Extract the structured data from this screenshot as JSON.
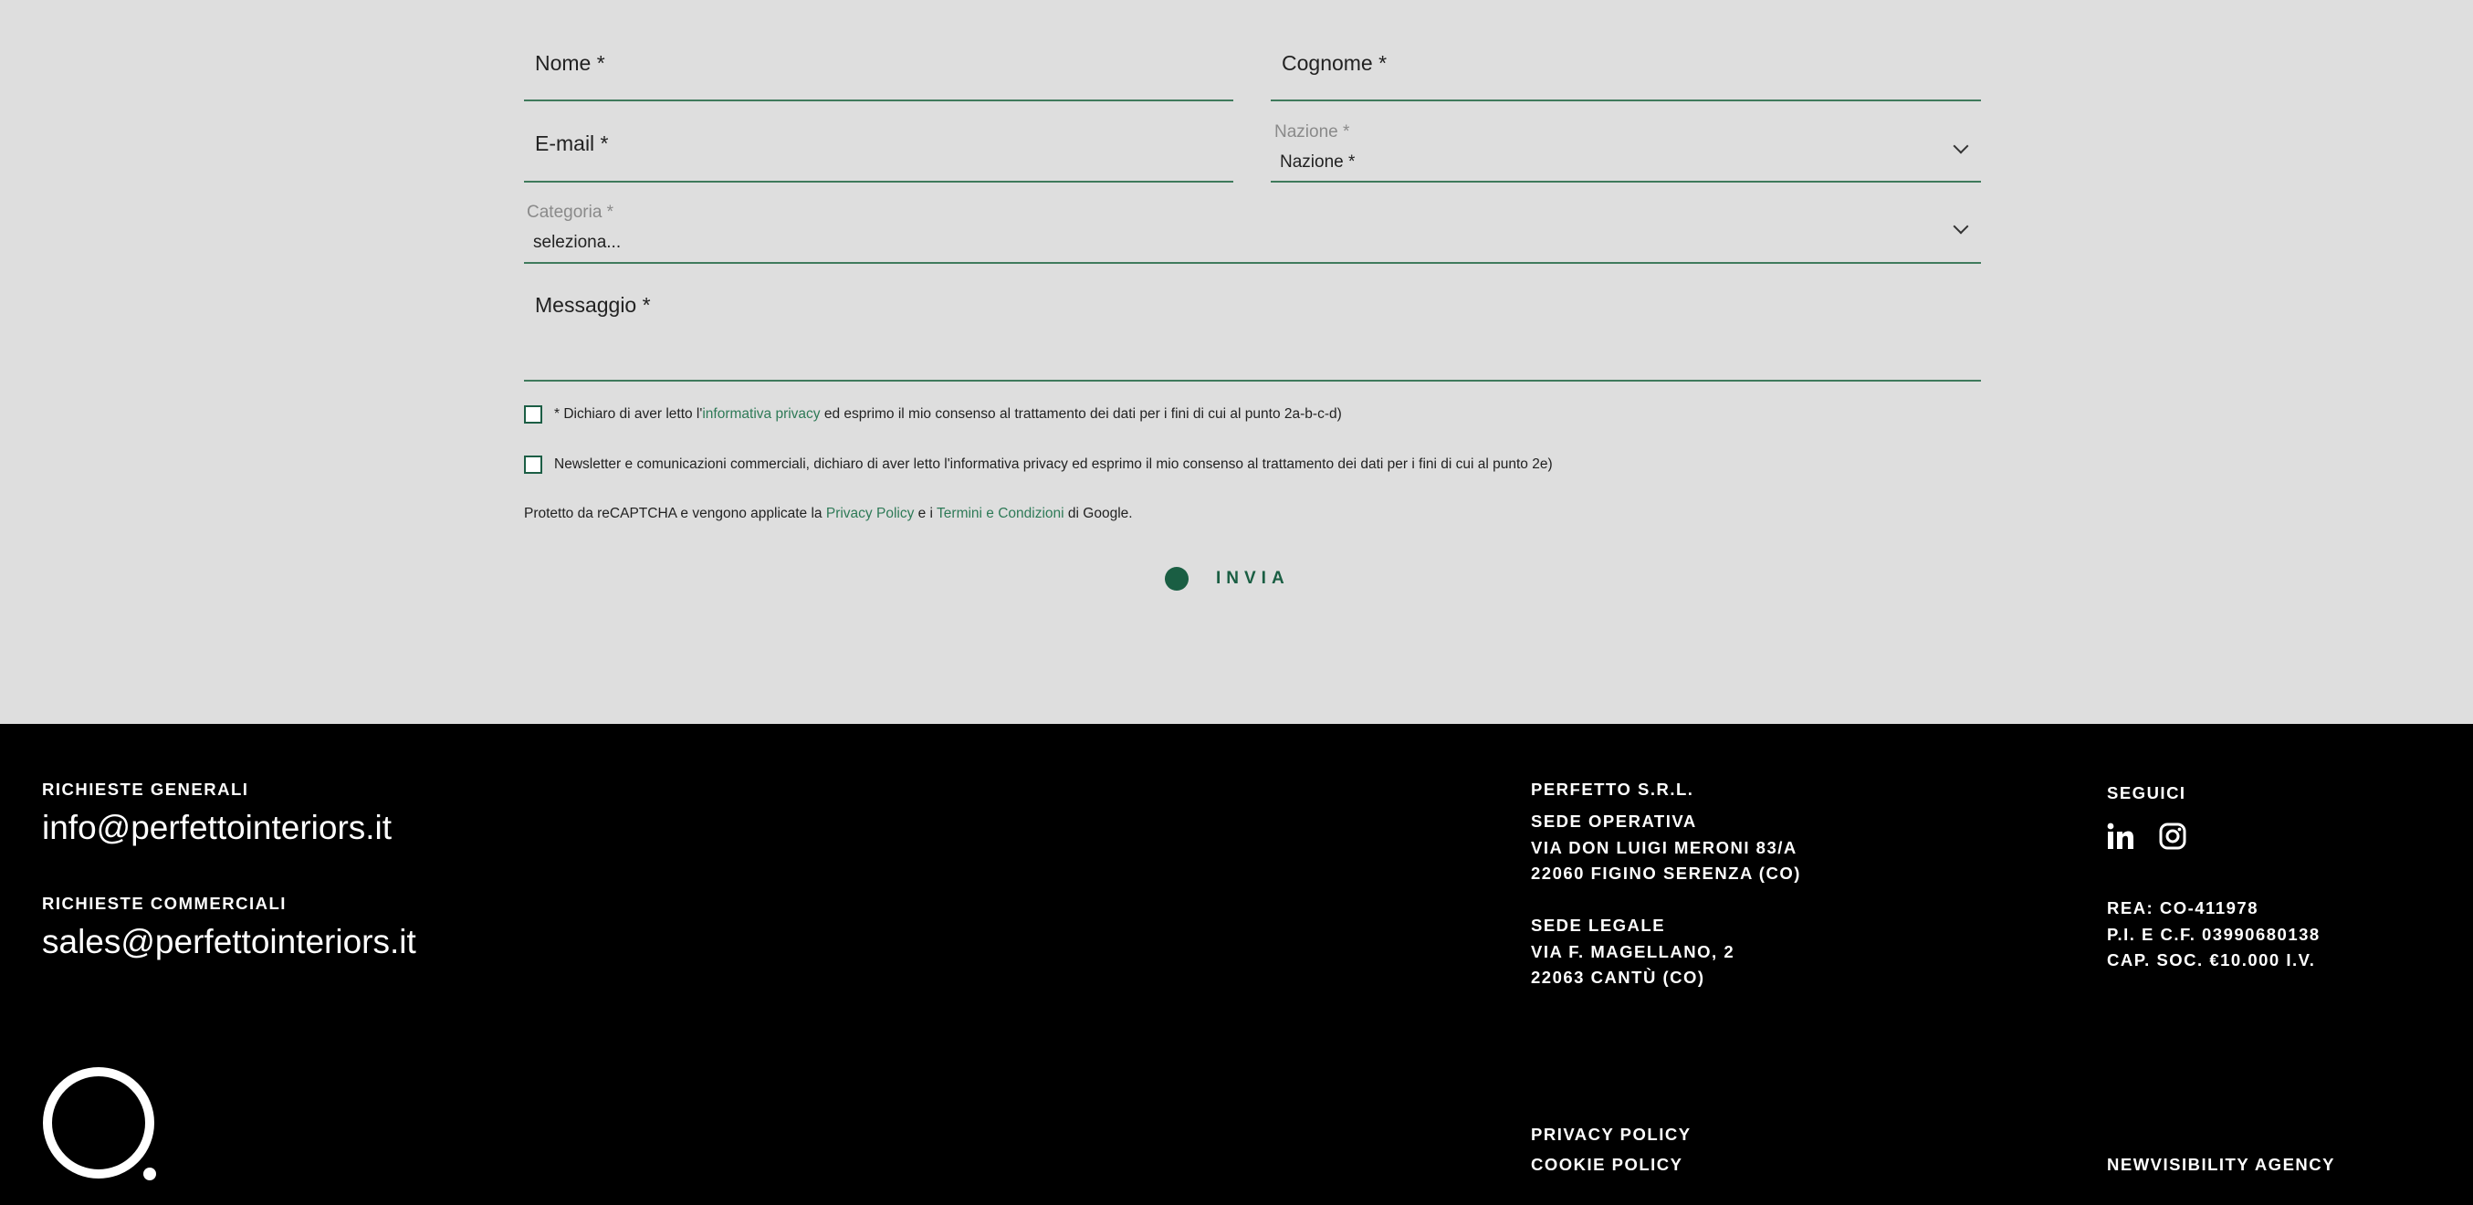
{
  "form": {
    "nome": "Nome *",
    "cognome": "Cognome *",
    "email": "E-mail *",
    "nazione_label": "Nazione *",
    "nazione_value": "Nazione *",
    "categoria_label": "Categoria *",
    "categoria_value": "seleziona...",
    "messaggio": "Messaggio *",
    "consent1_pre": "* Dichiaro di aver letto l'",
    "consent1_link": "informativa privacy",
    "consent1_post": " ed esprimo il mio consenso al trattamento dei dati per i fini di cui al punto 2a-b-c-d)",
    "consent2": "Newsletter e comunicazioni commerciali, dichiaro di aver letto l'informativa privacy ed esprimo il mio consenso al trattamento dei dati per i fini di cui al punto 2e)",
    "recaptcha_pre": "Protetto da reCAPTCHA e vengono applicate la ",
    "recaptcha_privacy": "Privacy Policy",
    "recaptcha_mid": " e i ",
    "recaptcha_terms": "Termini e Condizioni",
    "recaptcha_post": " di Google.",
    "submit": "INVIA"
  },
  "footer": {
    "general_heading": "RICHIESTE GENERALI",
    "general_email": "info@perfettointeriors.it",
    "commercial_heading": "RICHIESTE COMMERCIALI",
    "commercial_email": "sales@perfettointeriors.it",
    "company_name": "PERFETTO S.R.L.",
    "office_lines": [
      "SEDE OPERATIVA",
      "VIA DON LUIGI MERONI 83/A",
      "22060 FIGINO SERENZA (CO)"
    ],
    "legal_lines": [
      "SEDE LEGALE",
      "VIA F. MAGELLANO, 2",
      "22063 CANTÙ (CO)"
    ],
    "follow_heading": "SEGUICI",
    "registry_lines": [
      "REA: CO-411978",
      "P.I. E C.F. 03990680138",
      "CAP. SOC. €10.000 I.V."
    ],
    "privacy_policy": "PRIVACY POLICY",
    "cookie_policy": "COOKIE POLICY",
    "agency": "NEWVISIBILITY AGENCY"
  },
  "colors": {
    "form_bg": "#dedede",
    "accent_green": "#1a5e43",
    "footer_bg": "#000000"
  },
  "icons": [
    "linkedin-icon",
    "instagram-icon",
    "chevron-down-icon",
    "logo-mark"
  ]
}
